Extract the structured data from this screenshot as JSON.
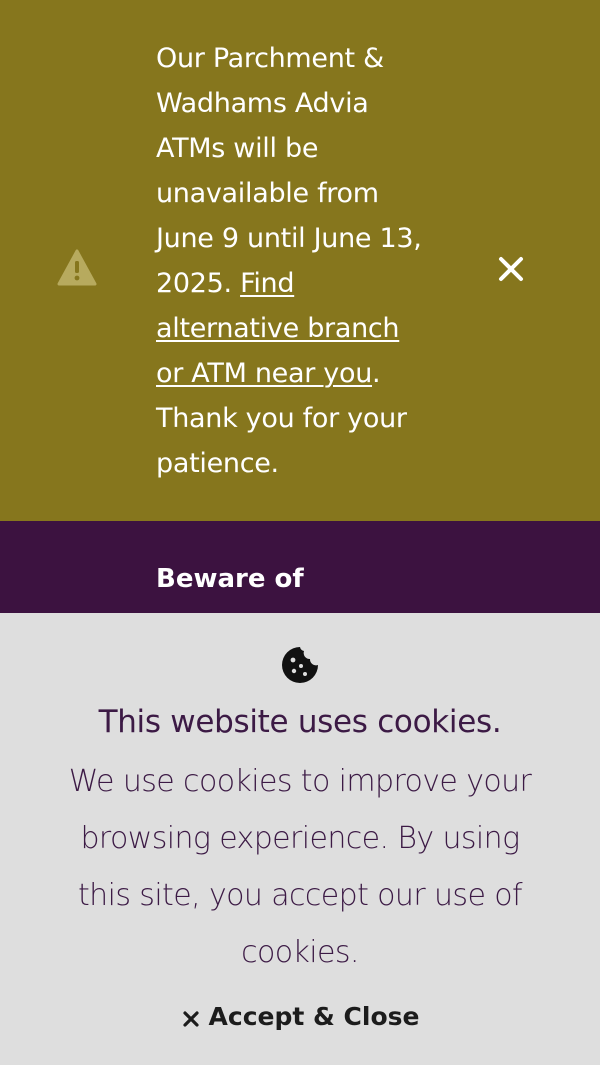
{
  "alert": {
    "icon": "warning-triangle-icon",
    "text_before_link": "Our Parchment & Wadhams Advia ATMs will be unavailable from June 9 until June 13, 2025. ",
    "link_text": "Find alternative branch or ATM near you",
    "text_after_link": ". Thank you for your patience.",
    "close_icon": "close-icon",
    "background_color": "#86761d"
  },
  "notice": {
    "title": "Beware of",
    "background_color": "#3c1240"
  },
  "cookie_banner": {
    "icon": "cookie-icon",
    "heading": "This website uses cookies.",
    "body": "We use cookies to improve your browsing experience. By using this site, you accept our use of cookies.",
    "accept_icon": "close-x-icon",
    "accept_label": "Accept & Close",
    "background_color": "#dedede",
    "text_color": "#3c1a45"
  }
}
